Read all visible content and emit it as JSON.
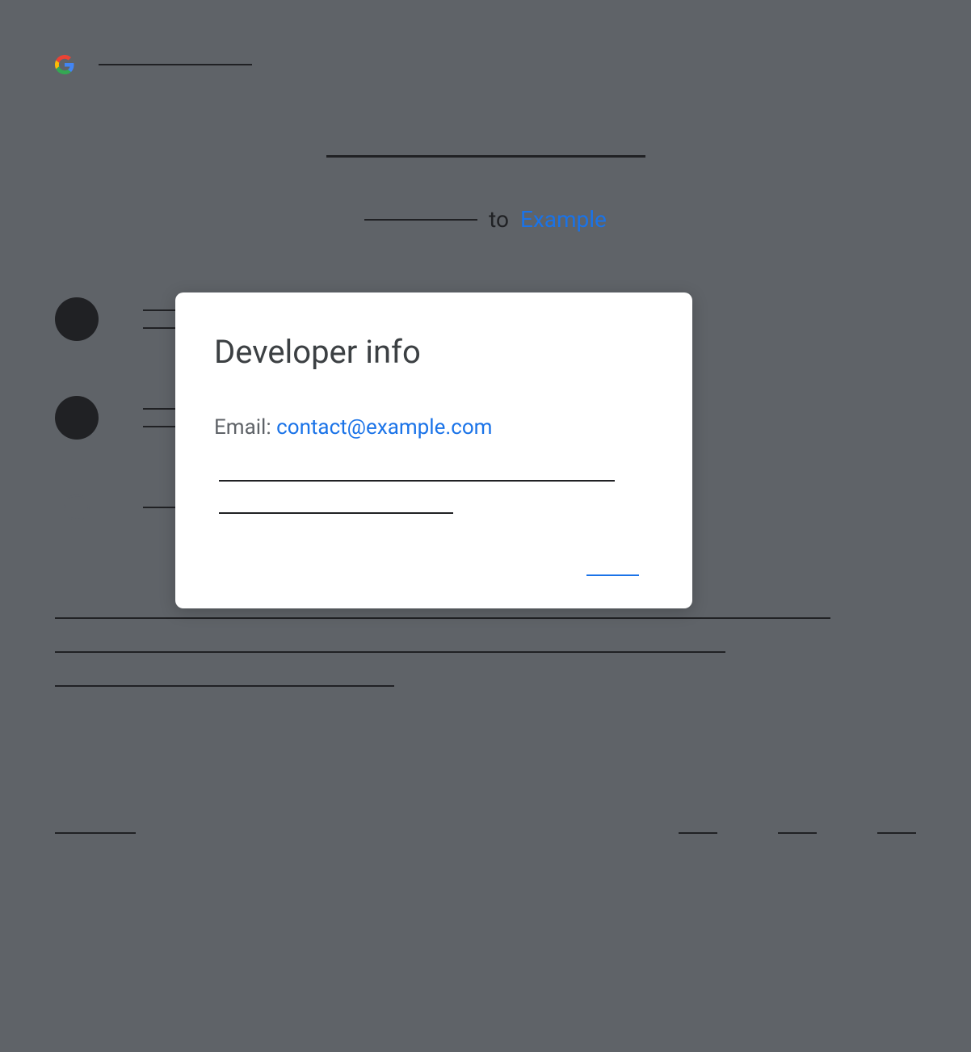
{
  "background": {
    "subtitle_connector": "to",
    "subtitle_link": "Example"
  },
  "dialog": {
    "title": "Developer info",
    "email_label": "Email: ",
    "email_value": "contact@example.com"
  }
}
